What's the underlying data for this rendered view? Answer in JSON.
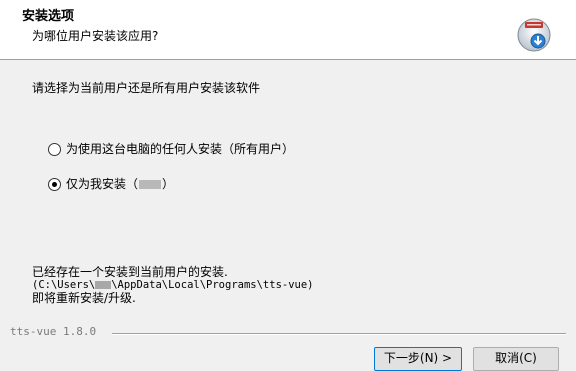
{
  "header": {
    "title": "安装选项",
    "subtitle": "为哪位用户安装该应用?",
    "icon": "installer-disk-icon"
  },
  "main": {
    "prompt": "请选择为当前用户还是所有用户安装该软件",
    "options": [
      {
        "label": "为使用这台电脑的任何人安装（所有用户）",
        "checked": false
      },
      {
        "label_prefix": "仅为我安装（",
        "label_suffix": "）",
        "checked": true
      }
    ],
    "info": {
      "line1": "已经存在一个安装到当前用户的安装.",
      "line2_prefix": "(C:\\Users\\",
      "line2_suffix": "\\AppData\\Local\\Programs\\tts-vue)",
      "line3": "即将重新安装/升级."
    }
  },
  "footer": {
    "brand": "tts-vue 1.8.0",
    "next_label": "下一步(N) >",
    "cancel_label": "取消(C)"
  }
}
